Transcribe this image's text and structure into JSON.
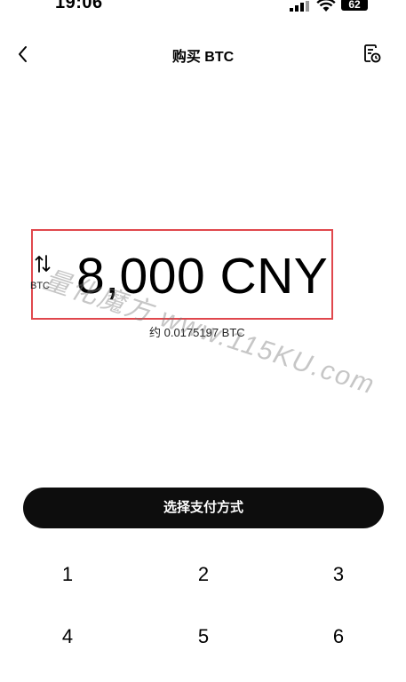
{
  "status_bar": {
    "time": "19:06",
    "battery_level": "62",
    "icons": [
      "signal-icon",
      "wifi-icon",
      "battery-icon"
    ]
  },
  "header": {
    "title": "购买 BTC",
    "back_icon": "chevron-left-icon",
    "history_icon": "order-history-icon"
  },
  "converter": {
    "switch_icon": "swap-vertical-arrows-icon",
    "switch_label": "BTC",
    "amount": "8,000 CNY",
    "approx": "约 0.0175197 BTC",
    "highlight_color": "#e0474c"
  },
  "watermark": {
    "text": "量化魔方 www.115KU.com"
  },
  "pay_button": {
    "label": "选择支付方式",
    "background": "#0d0d0d"
  },
  "keypad": {
    "keys": [
      "1",
      "2",
      "3",
      "4",
      "5",
      "6"
    ]
  }
}
